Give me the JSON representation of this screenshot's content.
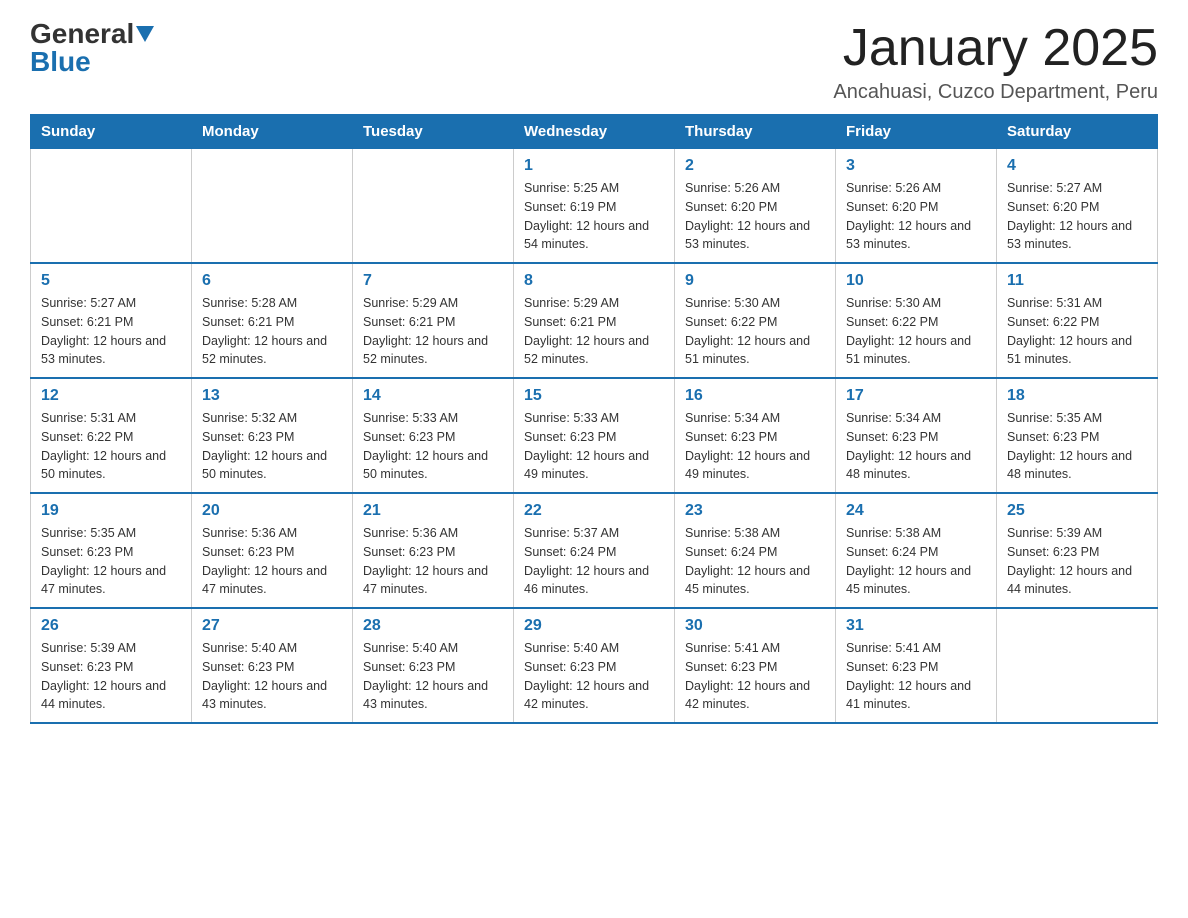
{
  "logo": {
    "general": "General",
    "blue": "Blue",
    "arrow": "▼"
  },
  "header": {
    "title": "January 2025",
    "subtitle": "Ancahuasi, Cuzco Department, Peru"
  },
  "weekdays": [
    "Sunday",
    "Monday",
    "Tuesday",
    "Wednesday",
    "Thursday",
    "Friday",
    "Saturday"
  ],
  "weeks": [
    [
      {
        "day": "",
        "info": ""
      },
      {
        "day": "",
        "info": ""
      },
      {
        "day": "",
        "info": ""
      },
      {
        "day": "1",
        "info": "Sunrise: 5:25 AM\nSunset: 6:19 PM\nDaylight: 12 hours and 54 minutes."
      },
      {
        "day": "2",
        "info": "Sunrise: 5:26 AM\nSunset: 6:20 PM\nDaylight: 12 hours and 53 minutes."
      },
      {
        "day": "3",
        "info": "Sunrise: 5:26 AM\nSunset: 6:20 PM\nDaylight: 12 hours and 53 minutes."
      },
      {
        "day": "4",
        "info": "Sunrise: 5:27 AM\nSunset: 6:20 PM\nDaylight: 12 hours and 53 minutes."
      }
    ],
    [
      {
        "day": "5",
        "info": "Sunrise: 5:27 AM\nSunset: 6:21 PM\nDaylight: 12 hours and 53 minutes."
      },
      {
        "day": "6",
        "info": "Sunrise: 5:28 AM\nSunset: 6:21 PM\nDaylight: 12 hours and 52 minutes."
      },
      {
        "day": "7",
        "info": "Sunrise: 5:29 AM\nSunset: 6:21 PM\nDaylight: 12 hours and 52 minutes."
      },
      {
        "day": "8",
        "info": "Sunrise: 5:29 AM\nSunset: 6:21 PM\nDaylight: 12 hours and 52 minutes."
      },
      {
        "day": "9",
        "info": "Sunrise: 5:30 AM\nSunset: 6:22 PM\nDaylight: 12 hours and 51 minutes."
      },
      {
        "day": "10",
        "info": "Sunrise: 5:30 AM\nSunset: 6:22 PM\nDaylight: 12 hours and 51 minutes."
      },
      {
        "day": "11",
        "info": "Sunrise: 5:31 AM\nSunset: 6:22 PM\nDaylight: 12 hours and 51 minutes."
      }
    ],
    [
      {
        "day": "12",
        "info": "Sunrise: 5:31 AM\nSunset: 6:22 PM\nDaylight: 12 hours and 50 minutes."
      },
      {
        "day": "13",
        "info": "Sunrise: 5:32 AM\nSunset: 6:23 PM\nDaylight: 12 hours and 50 minutes."
      },
      {
        "day": "14",
        "info": "Sunrise: 5:33 AM\nSunset: 6:23 PM\nDaylight: 12 hours and 50 minutes."
      },
      {
        "day": "15",
        "info": "Sunrise: 5:33 AM\nSunset: 6:23 PM\nDaylight: 12 hours and 49 minutes."
      },
      {
        "day": "16",
        "info": "Sunrise: 5:34 AM\nSunset: 6:23 PM\nDaylight: 12 hours and 49 minutes."
      },
      {
        "day": "17",
        "info": "Sunrise: 5:34 AM\nSunset: 6:23 PM\nDaylight: 12 hours and 48 minutes."
      },
      {
        "day": "18",
        "info": "Sunrise: 5:35 AM\nSunset: 6:23 PM\nDaylight: 12 hours and 48 minutes."
      }
    ],
    [
      {
        "day": "19",
        "info": "Sunrise: 5:35 AM\nSunset: 6:23 PM\nDaylight: 12 hours and 47 minutes."
      },
      {
        "day": "20",
        "info": "Sunrise: 5:36 AM\nSunset: 6:23 PM\nDaylight: 12 hours and 47 minutes."
      },
      {
        "day": "21",
        "info": "Sunrise: 5:36 AM\nSunset: 6:23 PM\nDaylight: 12 hours and 47 minutes."
      },
      {
        "day": "22",
        "info": "Sunrise: 5:37 AM\nSunset: 6:24 PM\nDaylight: 12 hours and 46 minutes."
      },
      {
        "day": "23",
        "info": "Sunrise: 5:38 AM\nSunset: 6:24 PM\nDaylight: 12 hours and 45 minutes."
      },
      {
        "day": "24",
        "info": "Sunrise: 5:38 AM\nSunset: 6:24 PM\nDaylight: 12 hours and 45 minutes."
      },
      {
        "day": "25",
        "info": "Sunrise: 5:39 AM\nSunset: 6:23 PM\nDaylight: 12 hours and 44 minutes."
      }
    ],
    [
      {
        "day": "26",
        "info": "Sunrise: 5:39 AM\nSunset: 6:23 PM\nDaylight: 12 hours and 44 minutes."
      },
      {
        "day": "27",
        "info": "Sunrise: 5:40 AM\nSunset: 6:23 PM\nDaylight: 12 hours and 43 minutes."
      },
      {
        "day": "28",
        "info": "Sunrise: 5:40 AM\nSunset: 6:23 PM\nDaylight: 12 hours and 43 minutes."
      },
      {
        "day": "29",
        "info": "Sunrise: 5:40 AM\nSunset: 6:23 PM\nDaylight: 12 hours and 42 minutes."
      },
      {
        "day": "30",
        "info": "Sunrise: 5:41 AM\nSunset: 6:23 PM\nDaylight: 12 hours and 42 minutes."
      },
      {
        "day": "31",
        "info": "Sunrise: 5:41 AM\nSunset: 6:23 PM\nDaylight: 12 hours and 41 minutes."
      },
      {
        "day": "",
        "info": ""
      }
    ]
  ]
}
